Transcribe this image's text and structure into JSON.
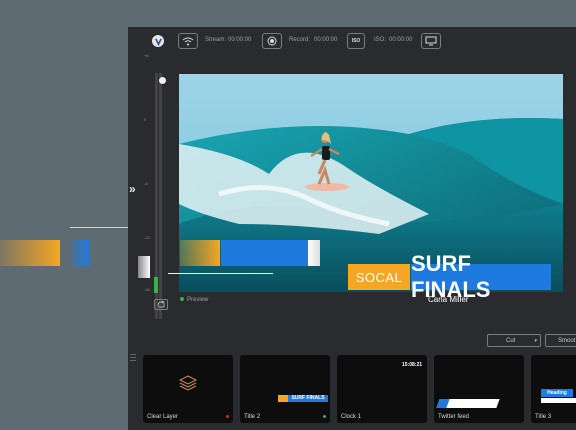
{
  "toolbar": {
    "stream_label": "Stream:",
    "stream_time": "00:00:00",
    "record_label": "Record:",
    "record_time": "00:00:00",
    "iso_badge": "ISO",
    "iso_label": "ISO:",
    "iso_time": "00:00:00"
  },
  "meter": {
    "tick_labels": [
      "+6",
      "0",
      "-6",
      "-12",
      "-18"
    ]
  },
  "expand_glyph": "»",
  "preview": {
    "label": "Preview",
    "lower_third": {
      "tag": "SOCAL",
      "title": "SURF FINALS",
      "name": "Carla Miller"
    }
  },
  "transitions": {
    "cut_label": "Cut",
    "smooth_label": "Smoot"
  },
  "tiles": [
    {
      "label": "Clear Layer",
      "dot_color": "#d0272a",
      "thumb_text": ""
    },
    {
      "label": "Title 2",
      "dot_color": "#38b24a",
      "thumb_text": "SURF FINALS"
    },
    {
      "label": "Clock 1",
      "dot_color": "",
      "thumb_text": "15:08:21"
    },
    {
      "label": "Twitter feed",
      "dot_color": "",
      "thumb_text": ""
    },
    {
      "label": "Title 3",
      "dot_color": "",
      "thumb_text": "Heading"
    }
  ],
  "colors": {
    "accent_blue": "#1f7ae0",
    "accent_orange": "#f5a623",
    "tally_green": "#38b24a",
    "tally_red": "#d0272a"
  }
}
